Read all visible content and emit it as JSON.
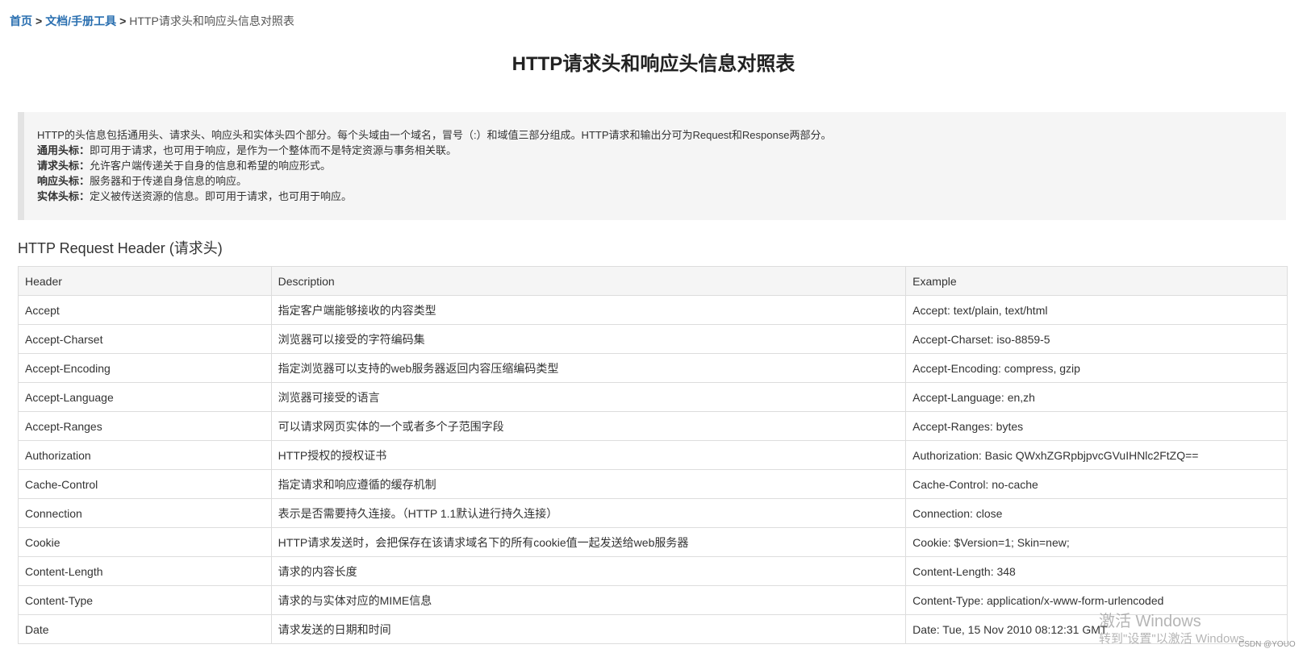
{
  "breadcrumb": {
    "home": "首页",
    "separator": ">",
    "category": "文档/手册工具",
    "current": "HTTP请求头和响应头信息对照表"
  },
  "page": {
    "title": "HTTP请求头和响应头信息对照表"
  },
  "intro": {
    "summary": "HTTP的头信息包括通用头、请求头、响应头和实体头四个部分。每个头域由一个域名，冒号（:）和域值三部分组成。HTTP请求和输出分可为Request和Response两部分。",
    "items": [
      {
        "term": "通用头标：",
        "text": "即可用于请求，也可用于响应，是作为一个整体而不是特定资源与事务相关联。"
      },
      {
        "term": "请求头标：",
        "text": "允许客户端传递关于自身的信息和希望的响应形式。"
      },
      {
        "term": "响应头标：",
        "text": "服务器和于传递自身信息的响应。"
      },
      {
        "term": "实体头标：",
        "text": "定义被传送资源的信息。即可用于请求，也可用于响应。"
      }
    ]
  },
  "request_section": {
    "title": "HTTP Request Header (请求头)",
    "columns": [
      "Header",
      "Description",
      "Example"
    ],
    "rows": [
      [
        "Accept",
        "指定客户端能够接收的内容类型",
        "Accept: text/plain, text/html"
      ],
      [
        "Accept-Charset",
        "浏览器可以接受的字符编码集",
        "Accept-Charset: iso-8859-5"
      ],
      [
        "Accept-Encoding",
        "指定浏览器可以支持的web服务器返回内容压缩编码类型",
        "Accept-Encoding: compress, gzip"
      ],
      [
        "Accept-Language",
        "浏览器可接受的语言",
        "Accept-Language: en,zh"
      ],
      [
        "Accept-Ranges",
        "可以请求网页实体的一个或者多个子范围字段",
        "Accept-Ranges: bytes"
      ],
      [
        "Authorization",
        "HTTP授权的授权证书",
        "Authorization: Basic QWxhZGRpbjpvcGVuIHNlc2FtZQ=="
      ],
      [
        "Cache-Control",
        "指定请求和响应遵循的缓存机制",
        "Cache-Control: no-cache"
      ],
      [
        "Connection",
        "表示是否需要持久连接。（HTTP 1.1默认进行持久连接）",
        "Connection: close"
      ],
      [
        "Cookie",
        "HTTP请求发送时，会把保存在该请求域名下的所有cookie值一起发送给web服务器",
        "Cookie: $Version=1; Skin=new;"
      ],
      [
        "Content-Length",
        "请求的内容长度",
        "Content-Length: 348"
      ],
      [
        "Content-Type",
        "请求的与实体对应的MIME信息",
        "Content-Type: application/x-www-form-urlencoded"
      ],
      [
        "Date",
        "请求发送的日期和时间",
        "Date: Tue, 15 Nov 2010 08:12:31 GMT"
      ]
    ]
  },
  "watermark": {
    "line1": "激活 Windows",
    "line2": "转到\"设置\"以激活 Windows",
    "credit": "CSDN @YOUO"
  },
  "colors": {
    "link": "#2a6fb0",
    "table_border": "#dddddd",
    "header_bg": "#f5f5f5",
    "intro_bg": "#f5f5f5",
    "intro_border": "#e3e3e3"
  }
}
